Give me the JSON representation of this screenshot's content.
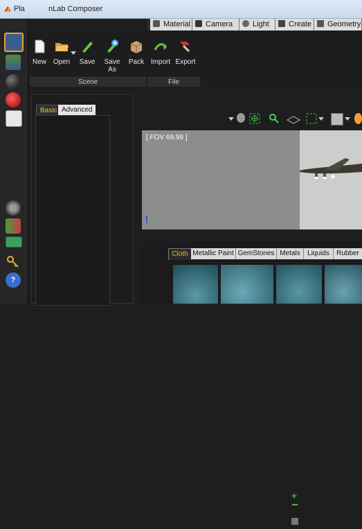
{
  "window": {
    "title_left": "Pla",
    "title_right": "nLab Composer"
  },
  "top_tabs": [
    {
      "label": "Material",
      "icon": "material-icon"
    },
    {
      "label": "Camera",
      "icon": "camera-icon"
    },
    {
      "label": "Light",
      "icon": "light-icon"
    },
    {
      "label": "Create",
      "icon": "create-icon"
    },
    {
      "label": "Geometry",
      "icon": "geometry-icon"
    }
  ],
  "ribbon": {
    "scene_buttons": [
      {
        "label": "New",
        "icon": "new-file-icon"
      },
      {
        "label": "Open",
        "icon": "folder-open-icon"
      },
      {
        "label": "Save",
        "icon": "save-icon"
      },
      {
        "label": "Save As",
        "icon": "save-as-icon"
      },
      {
        "label": "Pack",
        "icon": "pack-box-icon"
      }
    ],
    "file_buttons": [
      {
        "label": "Import",
        "icon": "import-icon"
      },
      {
        "label": "Export",
        "icon": "export-icon"
      }
    ],
    "groups": {
      "scene": "Scene",
      "file": "File"
    }
  },
  "left_panel": {
    "tabs": [
      "Basic",
      "Advanced"
    ],
    "active_tab": "Basic"
  },
  "viewport": {
    "fov_label": "[ FOV 69.99 ]"
  },
  "library": {
    "tabs": [
      "Cloth",
      "Metallic Paint",
      "GemStones",
      "Metals",
      "Liquids",
      "Rubber"
    ],
    "active_tab": "Cloth"
  },
  "colors": {
    "accent_orange": "#f0a030",
    "dark_bg": "#1e1e1e",
    "viewport_gray": "#8d8d8d",
    "viewport_light": "#cdcdcd"
  }
}
